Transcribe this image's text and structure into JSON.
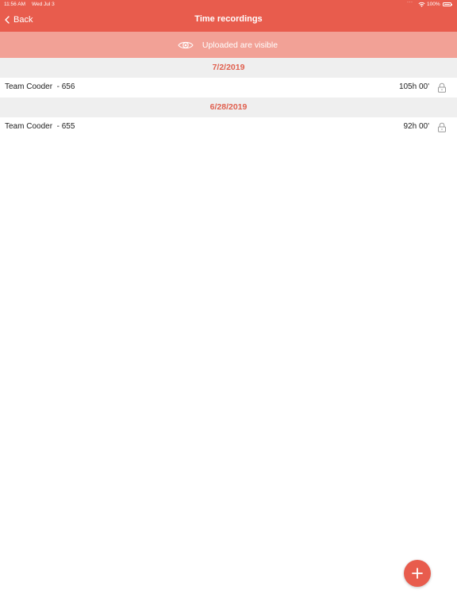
{
  "status_bar": {
    "time": "11:56 AM",
    "date": "Wed Jul 3",
    "battery": "100%"
  },
  "nav": {
    "back_label": "Back",
    "title": "Time recordings"
  },
  "banner": {
    "text": "Uploaded are visible",
    "icon": "eye-icon"
  },
  "sections": [
    {
      "date": "7/2/2019",
      "rows": [
        {
          "label": "Team Cooder  - 656",
          "duration": "105h 00'",
          "icon": "lock-icon"
        }
      ]
    },
    {
      "date": "6/28/2019",
      "rows": [
        {
          "label": "Team Cooder  - 655",
          "duration": "92h 00'",
          "icon": "lock-icon"
        }
      ]
    }
  ],
  "fab": {
    "icon": "plus-icon"
  },
  "colors": {
    "accent": "#e85c4d",
    "banner": "#f2a196",
    "section_bg": "#efefef",
    "section_text": "#e0604f"
  }
}
